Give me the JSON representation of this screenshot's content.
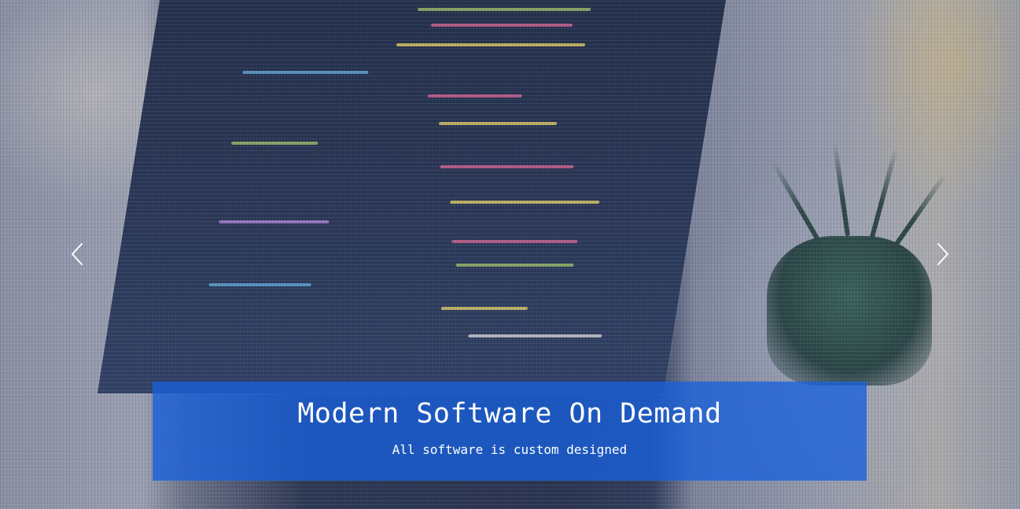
{
  "carousel": {
    "slide": {
      "title": "Modern Software On Demand",
      "subtitle": "All software is custom designed"
    },
    "prev_icon": "chevron-left-icon",
    "next_icon": "chevron-right-icon"
  },
  "colors": {
    "caption_background": "#1860dc",
    "caption_text": "#ffffff",
    "arrow": "#ffffff"
  }
}
